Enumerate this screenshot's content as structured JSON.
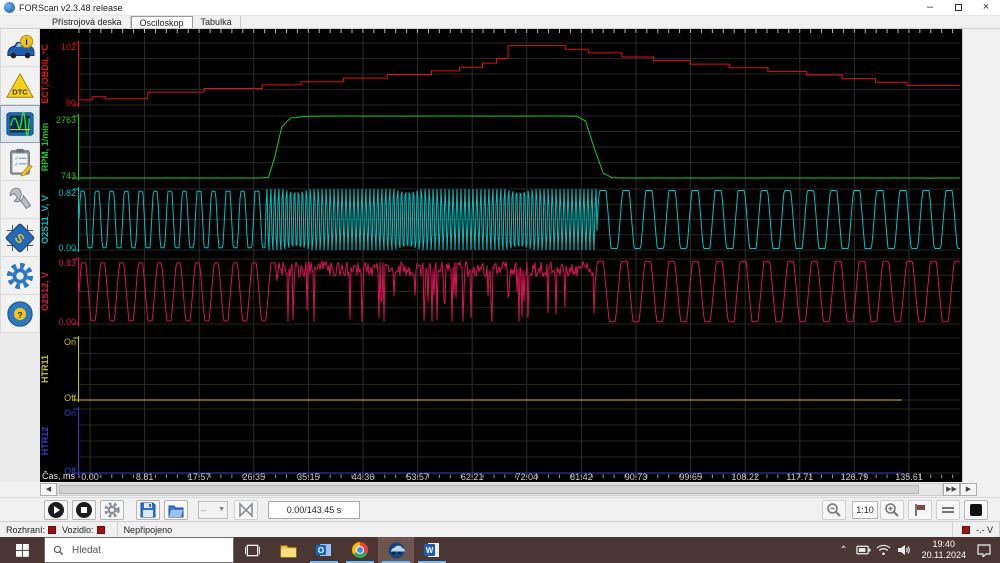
{
  "window": {
    "title": "FORScan v2.3.48 release"
  },
  "tabs": [
    {
      "label": "Přístrojová deska",
      "active": false
    },
    {
      "label": "Osciloskop",
      "active": true
    },
    {
      "label": "Tabulka",
      "active": false
    }
  ],
  "sidebar": {
    "items": [
      {
        "name": "vehicle-info"
      },
      {
        "name": "dtc"
      },
      {
        "name": "oscilloscope"
      },
      {
        "name": "tests"
      },
      {
        "name": "service"
      },
      {
        "name": "programming"
      },
      {
        "name": "settings"
      },
      {
        "name": "help"
      }
    ]
  },
  "oscilloscope": {
    "time_axis": {
      "label": "Čas, ms",
      "ticks": [
        "0.00",
        "8.81",
        "17.57",
        "26.35",
        "35.15",
        "44.36",
        "53.57",
        "62.21",
        "72.04",
        "81.42",
        "90.73",
        "99.65",
        "108.22",
        "117.71",
        "126.79",
        "135.61"
      ]
    },
    "channels": [
      {
        "label": "ECT,OBDII, °C",
        "color": "#e01212",
        "max_label": "102",
        "min_label": "90",
        "vmin": 90,
        "vmax": 102,
        "trace": {
          "type": "step",
          "points": [
            [
              0,
              91.0
            ],
            [
              0.015,
              91.6
            ],
            [
              0.03,
              91.2
            ],
            [
              0.072,
              91.2
            ],
            [
              0.078,
              92.5
            ],
            [
              0.135,
              92.5
            ],
            [
              0.142,
              93.2
            ],
            [
              0.2,
              93.2
            ],
            [
              0.208,
              93.9
            ],
            [
              0.245,
              93.9
            ],
            [
              0.252,
              94.5
            ],
            [
              0.29,
              94.5
            ],
            [
              0.3,
              95.2
            ],
            [
              0.34,
              95.2
            ],
            [
              0.35,
              95.9
            ],
            [
              0.39,
              95.9
            ],
            [
              0.4,
              96.6
            ],
            [
              0.425,
              96.6
            ],
            [
              0.432,
              97.3
            ],
            [
              0.452,
              97.3
            ],
            [
              0.458,
              98.1
            ],
            [
              0.468,
              98.1
            ],
            [
              0.474,
              99.0
            ],
            [
              0.48,
              99.0
            ],
            [
              0.487,
              101.5
            ],
            [
              0.545,
              101.5
            ],
            [
              0.552,
              100.8
            ],
            [
              0.572,
              100.8
            ],
            [
              0.578,
              100.1
            ],
            [
              0.608,
              100.1
            ],
            [
              0.616,
              99.3
            ],
            [
              0.645,
              99.3
            ],
            [
              0.652,
              98.6
            ],
            [
              0.687,
              98.6
            ],
            [
              0.694,
              97.9
            ],
            [
              0.73,
              97.9
            ],
            [
              0.738,
              97.2
            ],
            [
              0.774,
              97.2
            ],
            [
              0.782,
              96.5
            ],
            [
              0.818,
              96.5
            ],
            [
              0.826,
              95.8
            ],
            [
              0.858,
              95.8
            ],
            [
              0.866,
              95.1
            ],
            [
              0.896,
              95.1
            ],
            [
              0.904,
              94.4
            ],
            [
              0.932,
              94.4
            ],
            [
              0.94,
              93.8
            ],
            [
              1,
              93.8
            ]
          ]
        }
      },
      {
        "label": "RPM, 1/min",
        "color": "#17cc17",
        "max_label": "2763",
        "min_label": "743",
        "vmin": 743,
        "vmax": 2763,
        "trace": {
          "type": "line",
          "points": [
            [
              0,
              743
            ],
            [
              0.205,
              743
            ],
            [
              0.215,
              760
            ],
            [
              0.222,
              1400
            ],
            [
              0.23,
              2400
            ],
            [
              0.24,
              2700
            ],
            [
              0.26,
              2755
            ],
            [
              0.3,
              2763
            ],
            [
              0.36,
              2757
            ],
            [
              0.42,
              2763
            ],
            [
              0.48,
              2758
            ],
            [
              0.54,
              2763
            ],
            [
              0.565,
              2755
            ],
            [
              0.575,
              2600
            ],
            [
              0.585,
              1700
            ],
            [
              0.595,
              900
            ],
            [
              0.605,
              755
            ],
            [
              0.615,
              743
            ],
            [
              0.955,
              743
            ],
            [
              0.965,
              735
            ],
            [
              0.975,
              741
            ],
            [
              1,
              741
            ]
          ]
        }
      },
      {
        "label": "O2S11_V, V",
        "color": "#00c2c2",
        "max_label": "0.82",
        "min_label": "0.00",
        "vmin": 0,
        "vmax": 0.82,
        "trace": {
          "type": "osc",
          "segments": [
            {
              "from": 0,
              "to": 0.212,
              "period": 0.0165,
              "lo": 0.03,
              "hi": 0.79,
              "k": 1.6
            },
            {
              "from": 0.212,
              "to": 0.588,
              "period": 0.0045,
              "lo": 0.0,
              "hi": 0.82,
              "k": 1.2
            },
            {
              "from": 0.588,
              "to": 1,
              "period": 0.0262,
              "lo": 0.02,
              "hi": 0.8,
              "k": 1.6
            }
          ]
        }
      },
      {
        "label": "O2S12, V",
        "color": "#d81355",
        "max_label": "0.83",
        "min_label": "0.00",
        "vmin": 0,
        "vmax": 0.83,
        "trace": {
          "type": "osc",
          "segments": [
            {
              "from": 0,
              "to": 0.225,
              "period": 0.0215,
              "lo": 0.04,
              "hi": 0.78,
              "k": 1.3
            },
            {
              "from": 0.225,
              "to": 0.585,
              "noise": true,
              "lo": 0.02,
              "hi": 0.82
            },
            {
              "from": 0.585,
              "to": 1,
              "period": 0.027,
              "lo": 0.03,
              "hi": 0.8,
              "k": 1.4
            }
          ]
        }
      },
      {
        "label": "HTR11",
        "color": "#c8c800",
        "max_label": "On",
        "min_label": "Off",
        "vmin": 0,
        "vmax": 1,
        "trace": {
          "type": "const",
          "value": 0,
          "endFrac": 0.934
        }
      },
      {
        "label": "HTR12",
        "color": "#3a3ad0",
        "max_label": "On",
        "min_label": "Off",
        "vmin": 0,
        "vmax": 1,
        "trace": {
          "type": "const",
          "value": 0,
          "endFrac": 0.934
        }
      }
    ]
  },
  "toolbar": {
    "time_display": "0.00/143.45 s",
    "zoom_ratio": "1:10",
    "combo_value": "–"
  },
  "statusbar": {
    "interface_label": "Rozhraní:",
    "vehicle_label": "Vozidlo:",
    "status": "Nepřipojeno",
    "voltage": "-.- V"
  },
  "taskbar": {
    "search_placeholder": "Hledat",
    "time": "19:40",
    "date": "20.11.2024"
  }
}
